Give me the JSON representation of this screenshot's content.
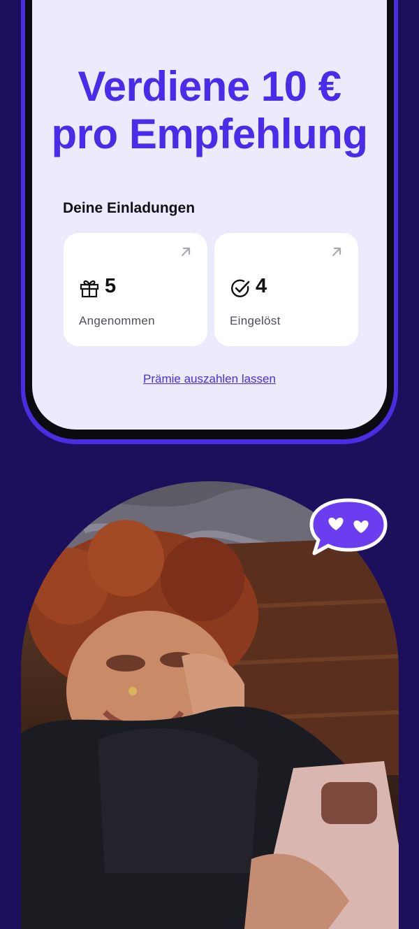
{
  "promo": {
    "headline_line1": "Verdiene 10 €",
    "headline_line2": "pro Empfehlung"
  },
  "invitations": {
    "section_title": "Deine Einladungen",
    "cards": [
      {
        "icon": "gift-icon",
        "value": "5",
        "label": "Angenommen"
      },
      {
        "icon": "check-circle-icon",
        "value": "4",
        "label": "Eingelöst"
      }
    ],
    "payout_link": "Prämie auszahlen lassen"
  },
  "colors": {
    "background": "#1c0f5c",
    "accent": "#4b2bea",
    "screen": "#ecebfd"
  }
}
